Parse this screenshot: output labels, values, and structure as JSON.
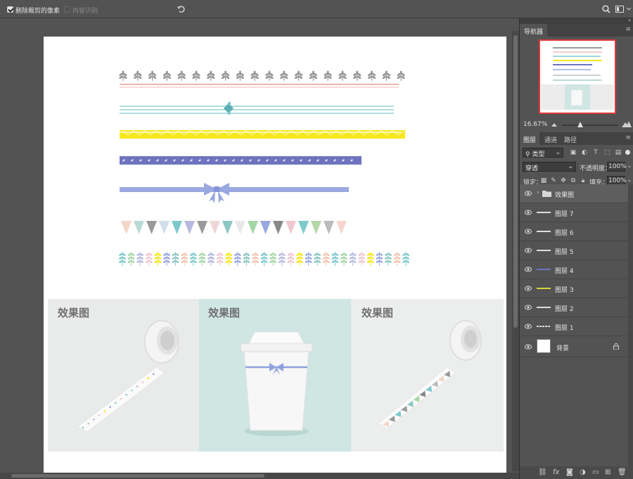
{
  "options_bar": {
    "delete_cropped_label": "删除裁剪的像素",
    "content_aware_label": "内容识别"
  },
  "navigator": {
    "tab_label": "导航器",
    "zoom_value": "16.67%"
  },
  "layers_panel": {
    "tabs": [
      "图层",
      "通道",
      "路径"
    ],
    "filter_kind": "类型",
    "blend_mode": "穿透",
    "opacity_label": "不透明度：",
    "opacity_value": "100%",
    "lock_label": "锁定：",
    "fill_label": "填充：",
    "fill_value": "100%",
    "layers": [
      {
        "name": "效果图",
        "type": "group"
      },
      {
        "name": "图层 7",
        "type": "layer"
      },
      {
        "name": "图层 6",
        "type": "layer"
      },
      {
        "name": "图层 5",
        "type": "layer"
      },
      {
        "name": "图层 4",
        "type": "layer"
      },
      {
        "name": "图层 3",
        "type": "layer"
      },
      {
        "name": "图层 2",
        "type": "layer"
      },
      {
        "name": "图层 1",
        "type": "layer"
      },
      {
        "name": "背景",
        "type": "background"
      }
    ]
  },
  "canvas": {
    "mockup_labels": [
      "效果图",
      "效果图",
      "效果图"
    ]
  },
  "colors": {
    "accent_red": "#e0383e",
    "panel_bg": "#535353",
    "tape_yellow": "#f6e81c",
    "tape_purple": "#6e74bf",
    "tape_lavender": "#9aa8e0",
    "tape_teal": "#7ec9cc",
    "tape_pink": "#ef9e9a"
  }
}
